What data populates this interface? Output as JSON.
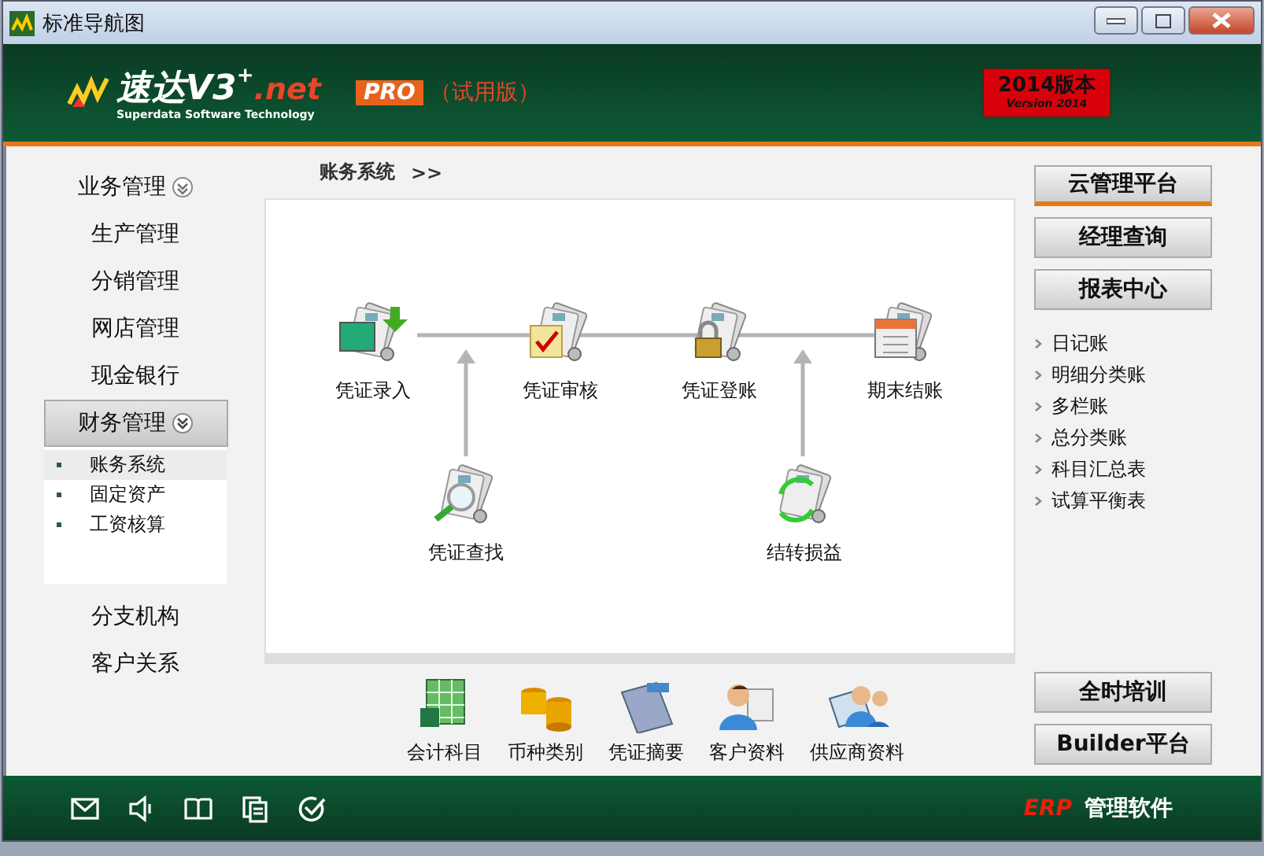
{
  "window": {
    "title": "标准导航图"
  },
  "header": {
    "logo_name": "速达V3",
    "logo_plus": "+",
    "logo_suffix": ".net",
    "tagline": "Superdata Software Technology",
    "edition": "PRO",
    "trial": "（试用版）",
    "version": {
      "title": "2014版本",
      "subtitle": "Version 2014"
    }
  },
  "sidebar": {
    "items": [
      {
        "label": "业务管理",
        "kind": "group",
        "expanded": false,
        "selected": false
      },
      {
        "label": "生产管理",
        "kind": "link"
      },
      {
        "label": "分销管理",
        "kind": "link"
      },
      {
        "label": "网店管理",
        "kind": "link"
      },
      {
        "label": "现金银行",
        "kind": "link"
      },
      {
        "label": "财务管理",
        "kind": "group",
        "expanded": true,
        "selected": true,
        "children": [
          {
            "label": "账务系统",
            "selected": true
          },
          {
            "label": "固定资产",
            "selected": false
          },
          {
            "label": "工资核算",
            "selected": false
          }
        ]
      },
      {
        "label": "分支机构",
        "kind": "link"
      },
      {
        "label": "客户关系",
        "kind": "link"
      }
    ]
  },
  "breadcrumb": {
    "label": "账务系统",
    "separator": ">>"
  },
  "flow": {
    "nodes": [
      {
        "label": "凭证录入",
        "kind": "entry"
      },
      {
        "label": "凭证审核",
        "kind": "audit"
      },
      {
        "label": "凭证登账",
        "kind": "post"
      },
      {
        "label": "期末结账",
        "kind": "close"
      },
      {
        "label": "凭证查找",
        "kind": "search"
      },
      {
        "label": "结转损益",
        "kind": "transfer"
      }
    ]
  },
  "tools": [
    {
      "label": "会计科目",
      "kind": "sheet"
    },
    {
      "label": "币种类别",
      "kind": "coins"
    },
    {
      "label": "凭证摘要",
      "kind": "folder"
    },
    {
      "label": "客户资料",
      "kind": "person"
    },
    {
      "label": "供应商资料",
      "kind": "people"
    }
  ],
  "right_panel": {
    "buttons": [
      {
        "label": "云管理平台",
        "selected": true
      },
      {
        "label": "经理查询",
        "selected": false
      },
      {
        "label": "报表中心",
        "selected": false
      }
    ],
    "reports": [
      "日记账",
      "明细分类账",
      "多栏账",
      "总分类账",
      "科目汇总表",
      "试算平衡表"
    ],
    "bottom_buttons": [
      "全时培训",
      "Builder平台"
    ]
  },
  "footer": {
    "brand": "ERP",
    "product": "管理软件"
  }
}
